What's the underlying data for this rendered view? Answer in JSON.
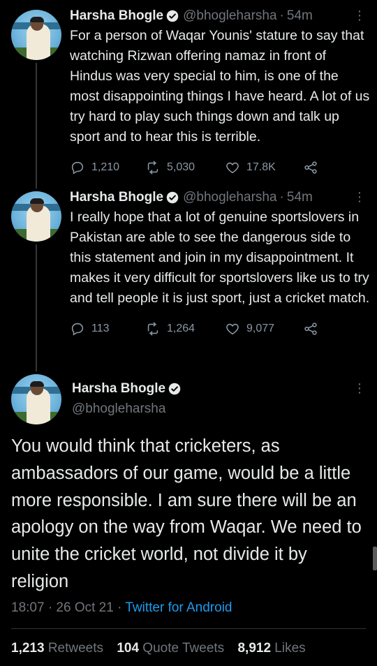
{
  "tweets": [
    {
      "name": "Harsha Bhogle",
      "handle": "@bhogleharsha",
      "time": "54m",
      "text": "For a person of Waqar Younis' stature to say that watching Rizwan offering namaz in front of Hindus was very special to him, is one of the most disappointing things I have heard. A lot of us try hard to play such things down and talk up sport and to hear this is terrible.",
      "replies": "1,210",
      "retweets": "5,030",
      "likes": "17.8K"
    },
    {
      "name": "Harsha Bhogle",
      "handle": "@bhogleharsha",
      "time": "54m",
      "text": "I really hope that a lot of genuine sportslovers in Pakistan are able to see the dangerous side to this statement and join in my disappointment. It makes it very difficult for sportslovers like us to try and tell people it is just sport, just a cricket match.",
      "replies": "113",
      "retweets": "1,264",
      "likes": "9,077"
    }
  ],
  "main_tweet": {
    "name": "Harsha Bhogle",
    "handle": "@bhogleharsha",
    "text": "You would think that cricketers, as ambassadors of our game, would be a little more responsible. I am sure there will be an apology on the way from Waqar. We need to unite the cricket world, not divide it by religion",
    "timestamp": "18:07 · 26 Oct 21 · ",
    "source": "Twitter for Android",
    "retweets": "1,213",
    "retweets_label": "Retweets",
    "quote_tweets": "104",
    "quote_tweets_label": "Quote Tweets",
    "likes": "8,912",
    "likes_label": "Likes"
  },
  "icons": {
    "verified": "verified-badge-icon",
    "more": "more-options-icon",
    "reply": "reply-icon",
    "retweet": "retweet-icon",
    "like": "heart-icon",
    "share": "share-icon"
  },
  "colors": {
    "background": "#000000",
    "text": "#e7e9ea",
    "secondary": "#71767b",
    "accent": "#1d9bf0"
  }
}
